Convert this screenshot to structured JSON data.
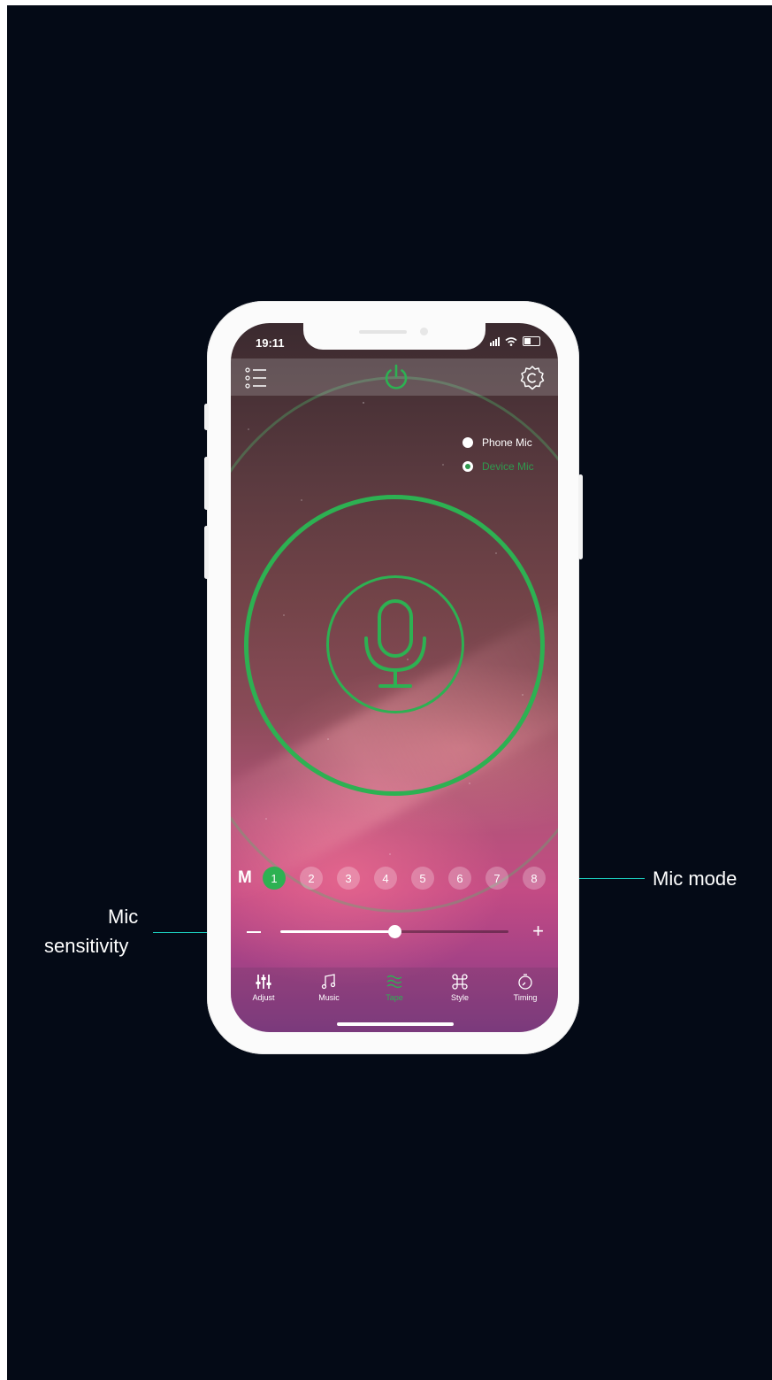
{
  "status": {
    "time": "19:11"
  },
  "mic_source": {
    "options": [
      {
        "label": "Phone Mic",
        "selected": false,
        "color": "#ffffff"
      },
      {
        "label": "Device Mic",
        "selected": true,
        "color": "#2f9a4e"
      }
    ]
  },
  "mode": {
    "label": "M",
    "buttons": [
      "1",
      "2",
      "3",
      "4",
      "5",
      "6",
      "7",
      "8"
    ],
    "active_index": 0
  },
  "sensitivity": {
    "value_fraction": 0.5,
    "minus_symbol": "−",
    "plus_symbol": "+"
  },
  "tabs": [
    {
      "label": "Adjust",
      "icon": "equalizer-icon",
      "active": false
    },
    {
      "label": "Music",
      "icon": "music-note-icon",
      "active": false
    },
    {
      "label": "Tape",
      "icon": "wave-icon",
      "active": true
    },
    {
      "label": "Style",
      "icon": "command-icon",
      "active": false
    },
    {
      "label": "Timing",
      "icon": "timer-icon",
      "active": false
    }
  ],
  "annotations": {
    "mic_mode": "Mic mode",
    "mic_sensitivity_line1": "Mic",
    "mic_sensitivity_line2": "sensitivity"
  },
  "colors": {
    "accent": "#2db152",
    "annotation": "#1ccfbf",
    "backdrop": "#040a16"
  }
}
